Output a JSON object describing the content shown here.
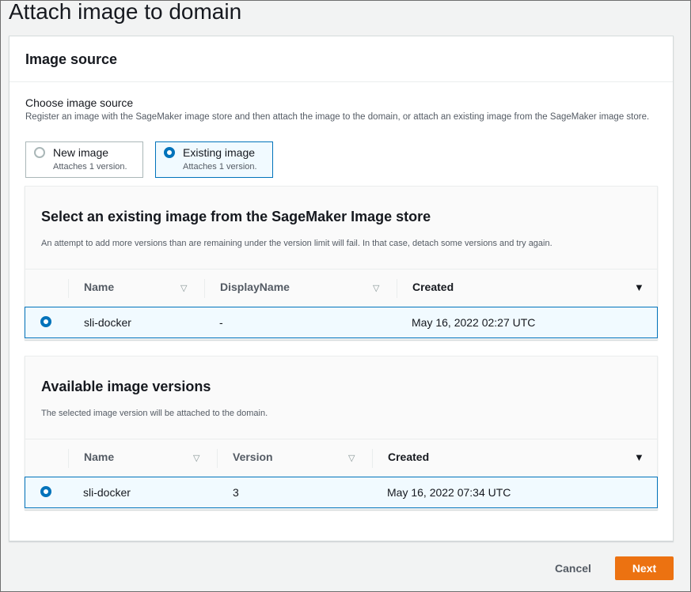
{
  "page": {
    "title": "Attach image to domain"
  },
  "image_source": {
    "header": "Image source",
    "label": "Choose image source",
    "description": "Register an image with the SageMaker image store and then attach the image to the domain, or attach an existing image from the SageMaker image store.",
    "options": [
      {
        "label": "New image",
        "sub": "Attaches 1 version.",
        "selected": false
      },
      {
        "label": "Existing image",
        "sub": "Attaches 1 version.",
        "selected": true
      }
    ]
  },
  "existing_images": {
    "title": "Select an existing image from the SageMaker Image store",
    "description": "An attempt to add more versions than are remaining under the version limit will fail. In that case, detach some versions and try again.",
    "columns": [
      "Name",
      "DisplayName",
      "Created"
    ],
    "rows": [
      {
        "name": "sli-docker",
        "display_name": "-",
        "created": "May 16, 2022 02:27 UTC",
        "selected": true
      }
    ]
  },
  "versions": {
    "title": "Available image versions",
    "description": "The selected image version will be attached to the domain.",
    "columns": [
      "Name",
      "Version",
      "Created"
    ],
    "rows": [
      {
        "name": "sli-docker",
        "version": "3",
        "created": "May 16, 2022 07:34 UTC",
        "selected": true
      }
    ]
  },
  "actions": {
    "cancel": "Cancel",
    "next": "Next"
  },
  "colors": {
    "accent": "#0073bb",
    "primary_button": "#ec7211"
  }
}
